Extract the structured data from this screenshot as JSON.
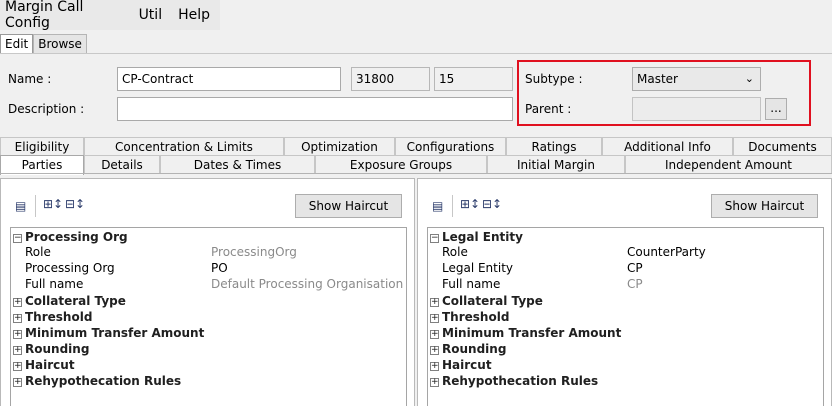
{
  "menu": [
    "Margin Call Config",
    "Util",
    "Help"
  ],
  "mode_tabs": [
    "Edit",
    "Browse"
  ],
  "form": {
    "name_label": "Name :",
    "name_value": "CP-Contract",
    "id_value": "31800",
    "version_value": "15",
    "description_label": "Description :",
    "description_value": "",
    "subtype_label": "Subtype :",
    "subtype_value": "Master",
    "parent_label": "Parent :",
    "parent_value": "",
    "browse_label": "..."
  },
  "tabs_row1": [
    "Eligibility",
    "Concentration & Limits",
    "Optimization",
    "Configurations",
    "Ratings",
    "Additional Info",
    "Documents"
  ],
  "tabs_row2": [
    "Parties",
    "Details",
    "Dates & Times",
    "Exposure Groups",
    "Initial Margin",
    "Independent Amount"
  ],
  "left_panel": {
    "show_haircut": "Show Haircut",
    "section": "Processing Org",
    "rows": [
      {
        "key": "Role",
        "value": "ProcessingOrg"
      },
      {
        "key": "Processing Org",
        "value": "PO"
      },
      {
        "key": "Full name",
        "value": "Default Processing Organisation"
      }
    ],
    "collapsed": [
      "Collateral Type",
      "Threshold",
      "Minimum Transfer Amount",
      "Rounding",
      "Haircut",
      "Rehypothecation Rules"
    ]
  },
  "right_panel": {
    "show_haircut": "Show Haircut",
    "section": "Legal Entity",
    "rows": [
      {
        "key": "Role",
        "value": "CounterParty"
      },
      {
        "key": "Legal Entity",
        "value": "CP"
      },
      {
        "key": "Full name",
        "value": "CP"
      }
    ],
    "collapsed": [
      "Collateral Type",
      "Threshold",
      "Minimum Transfer Amount",
      "Rounding",
      "Haircut",
      "Rehypothecation Rules"
    ]
  },
  "colors": {
    "highlight": "#e0101f"
  },
  "icons": [
    "table-icon",
    "expand-all-icon",
    "collapse-all-icon",
    "chevron-down-icon",
    "plus-box-icon",
    "minus-box-icon"
  ]
}
